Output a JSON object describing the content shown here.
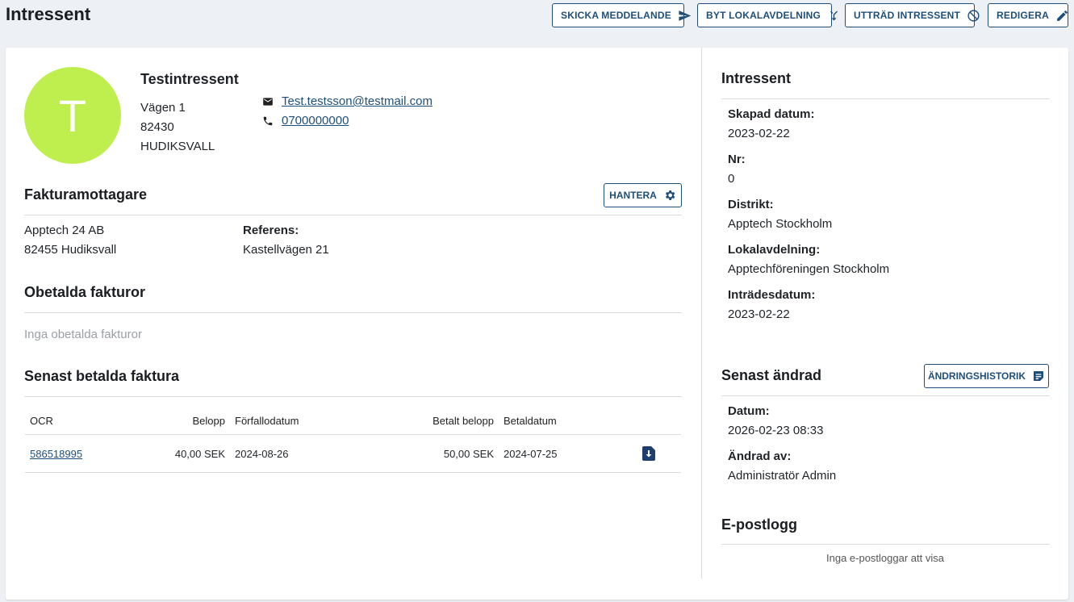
{
  "page_title": "Intressent",
  "actions": {
    "send_message": "SKICKA MEDDELANDE",
    "change_branch": "BYT LOKALAVDELNING",
    "withdraw": "UTTRÄD INTRESSENT",
    "edit": "REDIGERA"
  },
  "profile": {
    "avatar_letter": "T",
    "avatar_color": "#bfef4f",
    "name": "Testintressent",
    "address_line": "Vägen 1",
    "postal_code": "82430",
    "city": "HUDIKSVALL",
    "email": "Test.testsson@testmail.com",
    "phone": "0700000000"
  },
  "invoice_recipient": {
    "title": "Fakturamottagare",
    "manage_label": "HANTERA",
    "company": "Apptech 24 AB",
    "postal": "82455 Hudiksvall",
    "reference_label": "Referens:",
    "reference_value": "Kastellvägen 21"
  },
  "unpaid": {
    "title": "Obetalda fakturor",
    "empty_text": "Inga obetalda fakturor"
  },
  "last_paid": {
    "title": "Senast betalda faktura",
    "columns": [
      "OCR",
      "Belopp",
      "Förfallodatum",
      "Betalt belopp",
      "Betaldatum"
    ],
    "rows": [
      {
        "ocr": "586518995",
        "amount": "40,00 SEK",
        "due_date": "2024-08-26",
        "paid_amount": "50,00 SEK",
        "paid_date": "2024-07-25",
        "download_icon": "download-file-icon"
      }
    ]
  },
  "interest_panel": {
    "title": "Intressent",
    "fields": [
      {
        "label": "Skapad datum:",
        "value": "2023-02-22"
      },
      {
        "label": "Nr:",
        "value": "0"
      },
      {
        "label": "Distrikt:",
        "value": "Apptech Stockholm"
      },
      {
        "label": "Lokalavdelning:",
        "value": "Apptechföreningen Stockholm"
      },
      {
        "label": "Inträdesdatum:",
        "value": "2023-02-22"
      }
    ]
  },
  "last_changed": {
    "title": "Senast ändrad",
    "history_label": "ÄNDRINGSHISTORIK",
    "fields": [
      {
        "label": "Datum:",
        "value": "2026-02-23 08:33"
      },
      {
        "label": "Ändrad av:",
        "value": "Administratör Admin"
      }
    ]
  },
  "email_log": {
    "title": "E-postlogg",
    "empty_text": "Inga e-postloggar att visa"
  },
  "colors": {
    "primary": "#1e4f7a",
    "background": "#edf0f4",
    "avatar": "#bfef4f"
  }
}
